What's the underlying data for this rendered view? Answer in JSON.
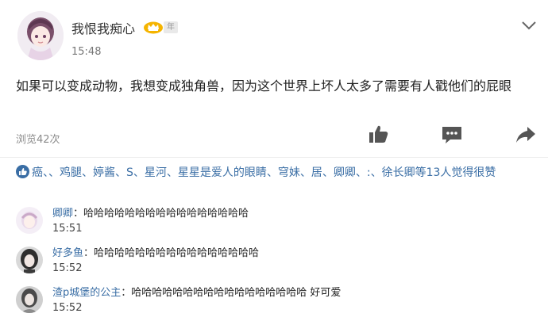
{
  "post": {
    "username": "我恨我痴心",
    "badge_text": "年",
    "time": "15:48",
    "content": "如果可以变成动物，我想变成独角兽，因为这个世界上坏人太多了需要有人戳他们的屁眼",
    "views": "浏览42次"
  },
  "likes": {
    "text": "癌、、鸡腿、婷酱、S、星河、星星是爱人的眼睛、穹妹、居、卿卿、:、徐长卿等13人觉得很赞"
  },
  "comments": [
    {
      "name": "卿卿",
      "text": "哈哈哈哈哈哈哈哈哈哈哈哈哈哈哈哈",
      "time": "15:51"
    },
    {
      "name": "好多鱼",
      "text": "哈哈哈哈哈哈哈哈哈哈哈哈哈哈哈哈",
      "time": "15:52"
    },
    {
      "name": "渣p城堡的公主",
      "text": "哈哈哈哈哈哈哈哈哈哈哈哈哈哈哈哈哈 好可爱",
      "time": "15:52"
    }
  ],
  "icons": {
    "dropdown": "chevron-down-icon",
    "like": "thumbs-up-icon",
    "comment": "comment-icon",
    "share": "share-icon",
    "likes_list": "thumbs-up-circle-icon",
    "vip": "crown-icon"
  },
  "colors": {
    "link": "#3a6ea5",
    "icon_gray": "#555555",
    "badge_gold": "#f5b400"
  }
}
